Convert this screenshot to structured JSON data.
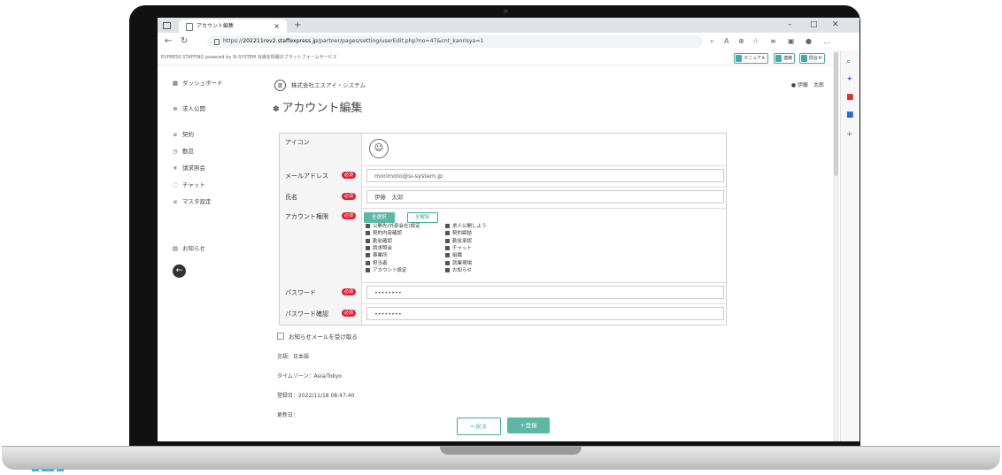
{
  "browser": {
    "tab_title": "アカウント編集",
    "tab_close": "×",
    "new_tab": "+",
    "url_prefix": "https://",
    "url_domain": "202211rev2.staffexpress.jp",
    "url_path": "/partner/pages/setting/userEdit.php?no=47&cnt_kanrisya=1",
    "min": "–",
    "max": "□",
    "close": "✕"
  },
  "header": {
    "brand": "EXPRESS STAFFING  powered by SI-SYSTEM   派遣友情報のプラットフォームサービス",
    "buttons": [
      "マニュアル",
      "連絡",
      "問合せ"
    ]
  },
  "sidebar": {
    "items": [
      {
        "icon": "▦",
        "label": "ダッシュボード"
      },
      {
        "icon": "⊕",
        "label": "求人公開"
      },
      {
        "icon": "⌀",
        "label": "契約"
      },
      {
        "icon": "◷",
        "label": "勤怠"
      },
      {
        "icon": "¥",
        "label": "請求照会"
      },
      {
        "icon": "◌",
        "label": "チャット"
      },
      {
        "icon": "⌀",
        "label": "マスタ設定"
      }
    ],
    "news": {
      "icon": "▤",
      "label": "お知らせ"
    },
    "back": "←"
  },
  "main": {
    "company": "株式会社エスアイ・システム",
    "user": "伊藤　太郎",
    "title": "アカウント編集",
    "required": "必須",
    "labels": {
      "icon": "アイコン",
      "email": "メールアドレス",
      "name": "氏名",
      "perm": "アカウント権限",
      "password": "パスワード",
      "password_confirm": "パスワード確認"
    },
    "values": {
      "email": "morimoto@si-system.jp",
      "name": "伊藤　太郎",
      "password": "••••••••",
      "password_confirm": "••••••••"
    },
    "select_all": "全選択",
    "deselect_all": "全解除",
    "perms_left": [
      "公開先(外部会社)設定",
      "契約内容確認",
      "勤怠確認",
      "請求照会",
      "事業所",
      "担当者",
      "アカウント設定"
    ],
    "perms_right": [
      "求人公開しよう",
      "契約締結",
      "勤怠承認",
      "チャット",
      "組織",
      "就業現場",
      "お知らせ"
    ],
    "notice_mail": "お知らせメールを受け取る",
    "language": "言語：日本語",
    "timezone": "タイムゾーン：Asia/Tokyo",
    "registered": "登録日：2022/11/18 08:47:40",
    "updated": "更新日：",
    "back_btn": "←戻る",
    "save_btn": "＋登録"
  }
}
